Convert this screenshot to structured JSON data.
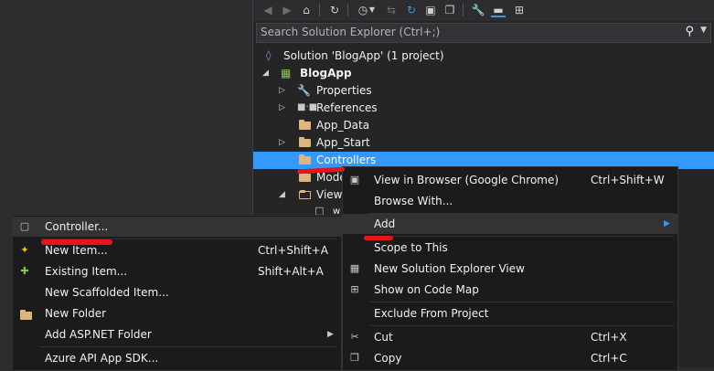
{
  "search": {
    "placeholder": "Search Solution Explorer (Ctrl+;)"
  },
  "tree": {
    "solution": "Solution 'BlogApp' (1 project)",
    "project": "BlogApp",
    "items": [
      {
        "label": "Properties"
      },
      {
        "label": "References"
      },
      {
        "label": "App_Data"
      },
      {
        "label": "App_Start"
      },
      {
        "label": "Controllers"
      },
      {
        "label": "Mode"
      },
      {
        "label": "Views"
      },
      {
        "label": "w"
      }
    ]
  },
  "context_menu": {
    "items": [
      {
        "label": "View in Browser (Google Chrome)",
        "shortcut": "Ctrl+Shift+W"
      },
      {
        "label": "Browse With...",
        "shortcut": ""
      },
      {
        "label": "Add",
        "shortcut": ""
      },
      {
        "label": "Scope to This",
        "shortcut": ""
      },
      {
        "label": "New Solution Explorer View",
        "shortcut": ""
      },
      {
        "label": "Show on Code Map",
        "shortcut": ""
      },
      {
        "label": "Exclude From Project",
        "shortcut": ""
      },
      {
        "label": "Cut",
        "shortcut": "Ctrl+X"
      },
      {
        "label": "Copy",
        "shortcut": "Ctrl+C"
      }
    ]
  },
  "add_submenu": {
    "items": [
      {
        "label": "Controller...",
        "shortcut": ""
      },
      {
        "label": "New Item...",
        "shortcut": "Ctrl+Shift+A"
      },
      {
        "label": "Existing Item...",
        "shortcut": "Shift+Alt+A"
      },
      {
        "label": "New Scaffolded Item...",
        "shortcut": ""
      },
      {
        "label": "New Folder",
        "shortcut": ""
      },
      {
        "label": "Add ASP.NET Folder",
        "shortcut": ""
      },
      {
        "label": "Azure API App SDK...",
        "shortcut": ""
      }
    ]
  },
  "colors": {
    "selection": "#3399ff",
    "folder": "#dcb67a",
    "annotation": "#e4161d"
  }
}
